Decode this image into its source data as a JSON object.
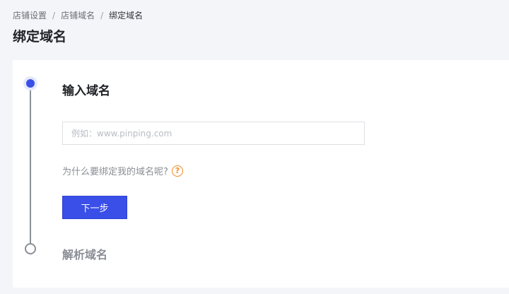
{
  "breadcrumb": {
    "items": [
      "店铺设置",
      "店铺域名",
      "绑定域名"
    ],
    "separator": "/"
  },
  "page_title": "绑定域名",
  "steps": [
    {
      "title": "输入域名",
      "state": "active"
    },
    {
      "title": "解析域名",
      "state": "inactive"
    }
  ],
  "domain_input": {
    "value": "",
    "placeholder": "例如：www.pinping.com"
  },
  "why_link": {
    "text": "为什么要绑定我的域名呢?",
    "icon": "question-circle-icon"
  },
  "next_button": {
    "label": "下一步"
  },
  "colors": {
    "primary": "#3a4ee8",
    "help_icon": "#f08a24",
    "muted_text": "#8a8e95",
    "page_bg": "#f4f5f8"
  }
}
